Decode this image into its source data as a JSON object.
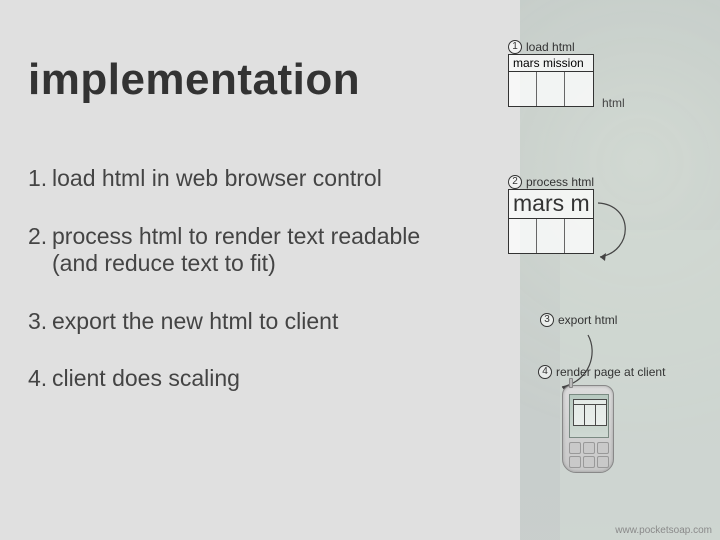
{
  "title": "implementation",
  "steps": [
    {
      "n": "1.",
      "text": "load html in web browser control"
    },
    {
      "n": "2.",
      "text": "process html to render text readable (and reduce text to fit)"
    },
    {
      "n": "3.",
      "text": "export the new html to client"
    },
    {
      "n": "4.",
      "text": "client does scaling"
    }
  ],
  "diag": {
    "step1": {
      "num": "1",
      "caption": "load html",
      "table_header": "mars mission",
      "side_caption": "html"
    },
    "step2": {
      "num": "2",
      "caption": "process html",
      "table_header": "mars m"
    },
    "step3": {
      "num": "3",
      "caption": "export html"
    },
    "step4": {
      "num": "4",
      "caption": "render page at client"
    }
  },
  "credit": "www.pocketsoap.com"
}
